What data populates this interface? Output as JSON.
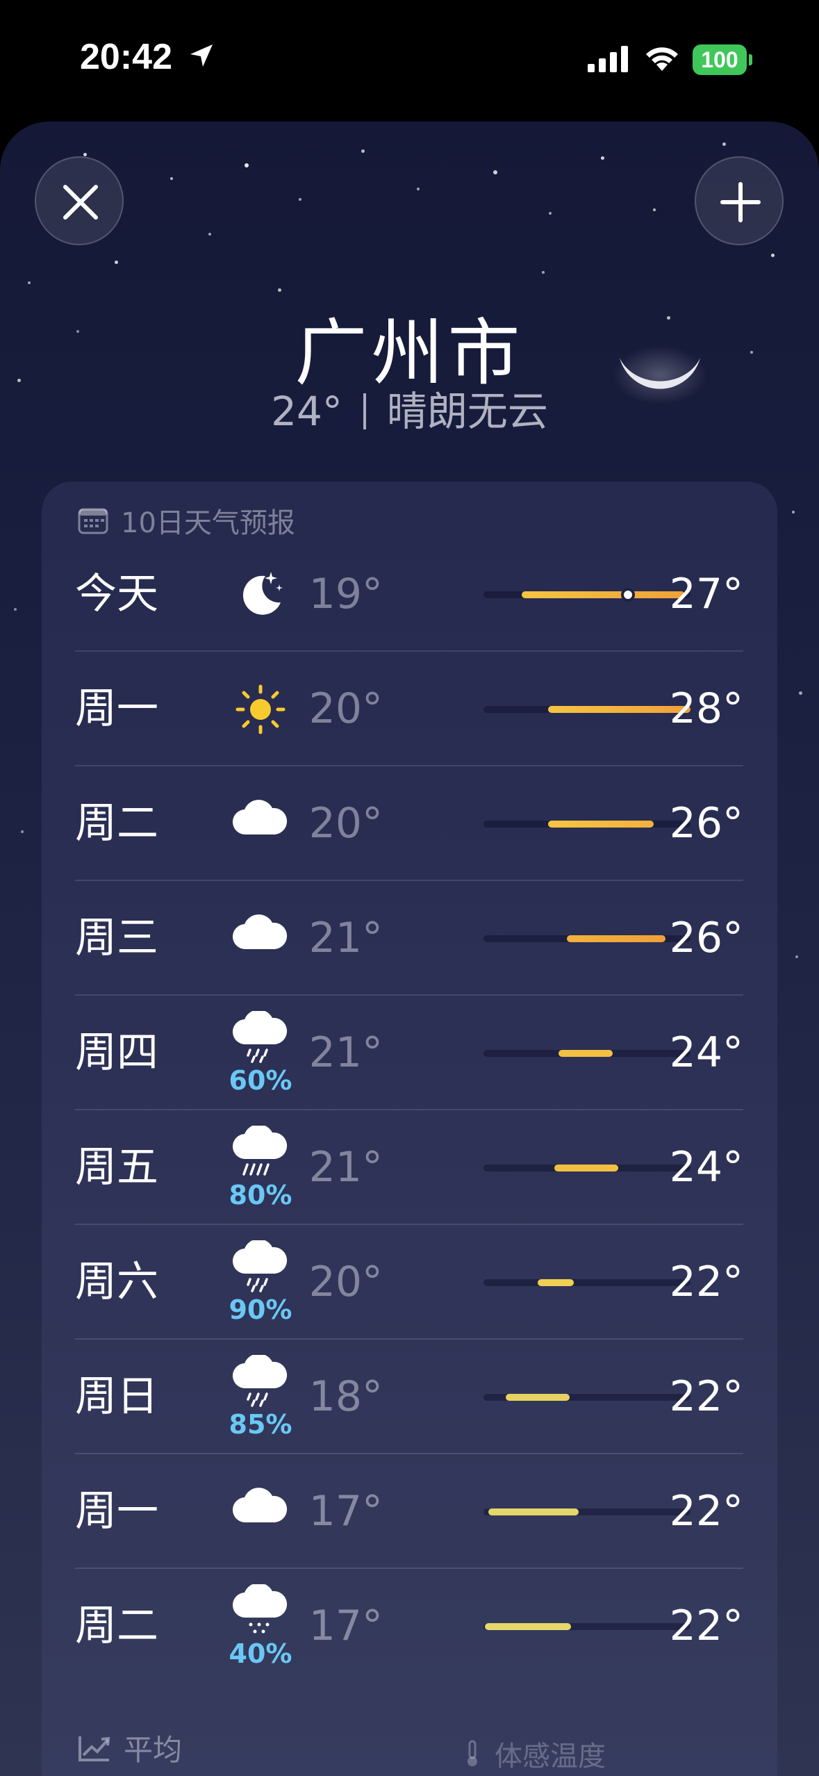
{
  "status_bar": {
    "time": "20:42",
    "battery": "100",
    "icons": [
      "location-arrow-icon",
      "cellular-signal-icon",
      "wifi-icon",
      "battery-icon"
    ]
  },
  "header": {
    "close_icon": "close-icon",
    "add_icon": "plus-icon",
    "city": "广州市",
    "current_temp": "24°",
    "condition": "晴朗无云"
  },
  "forecast": {
    "title": "10日天气预报",
    "title_icon": "calendar-icon",
    "days": [
      {
        "day": "今天",
        "icon": "moon-stars-icon",
        "precip": "",
        "low": "19°",
        "high": "27°"
      },
      {
        "day": "周一",
        "icon": "sun-icon",
        "precip": "",
        "low": "20°",
        "high": "28°"
      },
      {
        "day": "周二",
        "icon": "cloud-icon",
        "precip": "",
        "low": "20°",
        "high": "26°"
      },
      {
        "day": "周三",
        "icon": "cloud-icon",
        "precip": "",
        "low": "21°",
        "high": "26°"
      },
      {
        "day": "周四",
        "icon": "cloud-rain-icon",
        "precip": "60%",
        "low": "21°",
        "high": "24°"
      },
      {
        "day": "周五",
        "icon": "cloud-heavy-rain-icon",
        "precip": "80%",
        "low": "21°",
        "high": "24°"
      },
      {
        "day": "周六",
        "icon": "cloud-rain-icon",
        "precip": "90%",
        "low": "20°",
        "high": "22°"
      },
      {
        "day": "周日",
        "icon": "cloud-rain-icon",
        "precip": "85%",
        "low": "18°",
        "high": "22°"
      },
      {
        "day": "周一",
        "icon": "cloud-icon",
        "precip": "",
        "low": "17°",
        "high": "22°"
      },
      {
        "day": "周二",
        "icon": "cloud-drizzle-icon",
        "precip": "40%",
        "low": "17°",
        "high": "22°"
      }
    ]
  },
  "footer": {
    "average_label": "平均",
    "average_icon": "trend-chart-icon",
    "feels_like_label": "体感温度",
    "feels_like_icon": "thermometer-icon"
  }
}
